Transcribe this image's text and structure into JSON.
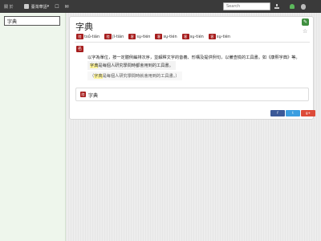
{
  "topbar": {
    "nav_label": "關  於",
    "lang_label": "臺灣華語",
    "lang_caret": "▾",
    "search_placeholder": "Search",
    "icons": [
      "chat-icon",
      "bookmark-icon",
      "download-icon",
      "android-icon",
      "apple-icon"
    ]
  },
  "sidebar": {
    "query": "字典"
  },
  "entry": {
    "title": "字典",
    "edit_icon": "✎",
    "star_icon": "☆",
    "pronunciations": [
      {
        "badge": "陸",
        "text": "tsū̍-tián"
      },
      {
        "badge": "陸",
        "text": "jī-tián"
      },
      {
        "badge": "客",
        "text": "sṳ-tién"
      },
      {
        "badge": "客",
        "text": "sṳ-tién"
      },
      {
        "badge": "客",
        "text": "sṳ-tién"
      },
      {
        "badge": "客",
        "text": "sṳ-tién"
      }
    ],
    "sense_badge": "名",
    "definition": "以字為單位，按一定體例編排次序，並解釋文字的音義、形構及提供例句，以備查檢的工具書。如《康熙字典》等。",
    "example1_hl": "字典",
    "example1_rest": "是每個人研究學問時都會用到的工具書。",
    "example2_prefix": "（",
    "example2_hl": "字典",
    "example2_rest": "是每個人研究學問時就會用到的工具書。）"
  },
  "related": {
    "badge": "陸",
    "text": "字典"
  },
  "share": [
    {
      "label": "f",
      "color": "#3b5998"
    },
    {
      "label": "t",
      "color": "#3b9ee0"
    },
    {
      "label": "g+",
      "color": "#dd4b39"
    }
  ],
  "colors": {
    "topbar": "#3a3a3a",
    "sidebar": "#eef6ec",
    "badge": "#a61d1d",
    "edit": "#3f8f3f",
    "highlight": "#fff59a"
  }
}
